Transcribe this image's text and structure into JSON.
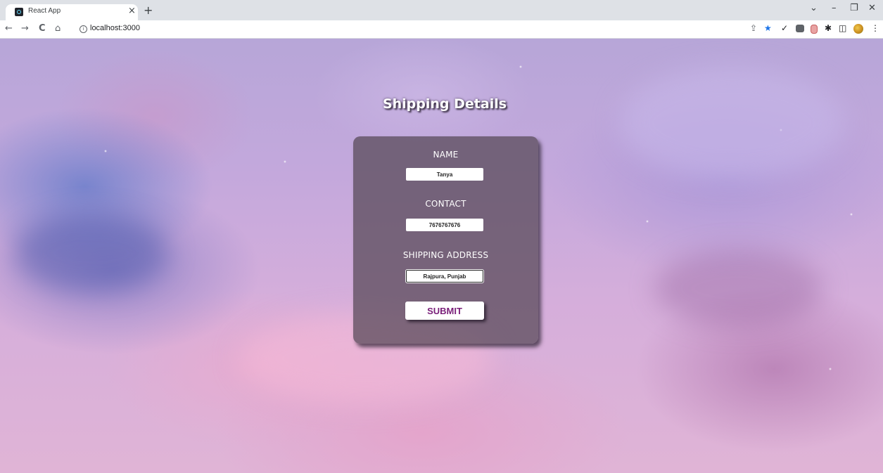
{
  "browser": {
    "tab_title": "React App",
    "tab_close": "×",
    "new_tab": "+",
    "url": "localhost:3000",
    "info": "i",
    "window_controls": {
      "chevron": "⌄",
      "minimize": "–",
      "restore": "❐",
      "close": "✕"
    },
    "nav": {
      "back": "←",
      "forward": "→",
      "reload": "C",
      "home": "⌂"
    },
    "extensions": {
      "share": "⇪",
      "bookmark": "★",
      "check": "✓",
      "puzzle": "✱",
      "sidepanel": "◫",
      "menu": "⋮"
    }
  },
  "page": {
    "heading": "Shipping Details",
    "form": {
      "name_label": "NAME",
      "name_value": "Tanya",
      "contact_label": "CONTACT",
      "contact_value": "7676767676",
      "address_label": "SHIPPING ADDRESS",
      "address_value": "Rajpura, Punjab",
      "submit_label": "SUBMIT"
    }
  },
  "colors": {
    "card_background": "#554655",
    "submit_text": "#7a1f7a",
    "bookmark_star": "#1a73e8"
  }
}
